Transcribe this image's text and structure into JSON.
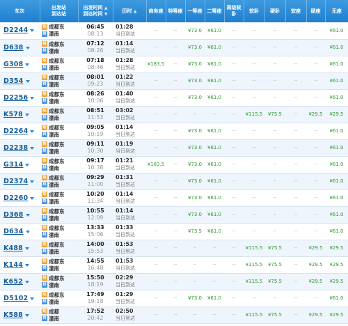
{
  "headers": {
    "train": "车次",
    "station_from": "出发站",
    "station_to": "到达站",
    "time_dep": "出发时间",
    "time_arr": "到达时间",
    "duration": "历时",
    "seats": [
      "商务座",
      "特等座",
      "一等座",
      "二等座",
      "高级软卧",
      "软卧",
      "硬卧",
      "软座",
      "硬座",
      "无座"
    ]
  },
  "colors": {
    "header_bg": "#1f7fcf",
    "train_link": "#135d9b",
    "available": "#2f9a2f",
    "row_alt": "#eef5fc"
  },
  "icons": {
    "start_station": "始",
    "end_station": "终"
  },
  "rows": [
    {
      "train": "D2244",
      "from": "成都东",
      "to": "潼南",
      "dep": "06:45",
      "arr": "08:13",
      "dur": "01:28",
      "day": "当日到达",
      "seats": [
        "--",
        "--",
        "¥73.0",
        "¥61.0",
        "--",
        "--",
        "--",
        "--",
        "--",
        "¥61.0"
      ]
    },
    {
      "train": "D638",
      "from": "成都东",
      "to": "潼南",
      "dep": "07:12",
      "arr": "08:26",
      "dur": "01:14",
      "day": "当日到达",
      "seats": [
        "--",
        "--",
        "¥73.0",
        "¥61.0",
        "--",
        "--",
        "--",
        "--",
        "--",
        "¥61.0"
      ]
    },
    {
      "train": "G308",
      "from": "成都东",
      "to": "潼南",
      "dep": "07:18",
      "arr": "08:46",
      "dur": "01:28",
      "day": "当日到达",
      "seats": [
        "¥183.5",
        "--",
        "¥73.0",
        "¥61.0",
        "--",
        "--",
        "--",
        "--",
        "--",
        "¥61.0"
      ]
    },
    {
      "train": "D354",
      "from": "成都东",
      "to": "潼南",
      "dep": "08:01",
      "arr": "09:23",
      "dur": "01:22",
      "day": "当日到达",
      "seats": [
        "--",
        "--",
        "¥73.0",
        "¥61.0",
        "--",
        "--",
        "--",
        "--",
        "--",
        "¥61.0"
      ]
    },
    {
      "train": "D2256",
      "from": "成都东",
      "to": "潼南",
      "dep": "08:26",
      "arr": "10:06",
      "dur": "01:40",
      "day": "当日到达",
      "seats": [
        "--",
        "--",
        "¥73.0",
        "¥61.0",
        "--",
        "--",
        "--",
        "--",
        "--",
        "¥61.0"
      ]
    },
    {
      "train": "K578",
      "from": "成都东",
      "to": "潼南",
      "dep": "08:51",
      "arr": "11:53",
      "dur": "03:02",
      "day": "当日到达",
      "seats": [
        "--",
        "--",
        "--",
        "--",
        "--",
        "¥115.5",
        "¥75.5",
        "--",
        "¥29.5",
        "¥29.5"
      ]
    },
    {
      "train": "D2264",
      "from": "成都东",
      "to": "潼南",
      "dep": "09:05",
      "arr": "10:19",
      "dur": "01:14",
      "day": "当日到达",
      "seats": [
        "--",
        "--",
        "¥73.0",
        "¥61.0",
        "--",
        "--",
        "--",
        "--",
        "--",
        "¥61.0"
      ]
    },
    {
      "train": "D2238",
      "from": "成都东",
      "to": "潼南",
      "dep": "09:11",
      "arr": "10:30",
      "dur": "01:19",
      "day": "当日到达",
      "seats": [
        "--",
        "--",
        "¥73.0",
        "¥61.0",
        "--",
        "--",
        "--",
        "--",
        "--",
        "¥61.0"
      ]
    },
    {
      "train": "G314",
      "from": "成都东",
      "to": "潼南",
      "dep": "09:17",
      "arr": "10:38",
      "dur": "01:21",
      "day": "当日到达",
      "seats": [
        "¥183.5",
        "--",
        "¥73.0",
        "¥61.0",
        "--",
        "--",
        "--",
        "--",
        "--",
        "¥61.0"
      ]
    },
    {
      "train": "D2374",
      "from": "成都东",
      "to": "潼南",
      "dep": "09:29",
      "arr": "11:00",
      "dur": "01:31",
      "day": "当日到达",
      "seats": [
        "--",
        "--",
        "¥73.0",
        "¥61.0",
        "--",
        "--",
        "--",
        "--",
        "--",
        "¥61.0"
      ]
    },
    {
      "train": "D2260",
      "from": "成都东",
      "to": "潼南",
      "dep": "10:20",
      "arr": "11:34",
      "dur": "01:14",
      "day": "当日到达",
      "seats": [
        "--",
        "--",
        "¥73.0",
        "¥61.0",
        "--",
        "--",
        "--",
        "--",
        "--",
        "¥61.0"
      ]
    },
    {
      "train": "D368",
      "from": "成都东",
      "to": "潼南",
      "dep": "10:55",
      "arr": "12:09",
      "dur": "01:14",
      "day": "当日到达",
      "seats": [
        "--",
        "--",
        "¥73.0",
        "¥61.0",
        "--",
        "--",
        "--",
        "--",
        "--",
        "¥61.0"
      ]
    },
    {
      "train": "D634",
      "from": "成都东",
      "to": "潼南",
      "dep": "13:33",
      "arr": "15:06",
      "dur": "01:33",
      "day": "当日到达",
      "seats": [
        "--",
        "--",
        "¥73.5",
        "¥61.0",
        "--",
        "--",
        "--",
        "--",
        "--",
        "¥61.0"
      ]
    },
    {
      "train": "K488",
      "from": "成都东",
      "to": "潼南",
      "dep": "14:00",
      "arr": "15:53",
      "dur": "01:53",
      "day": "当日到达",
      "seats": [
        "--",
        "--",
        "--",
        "--",
        "--",
        "¥115.5",
        "¥75.5",
        "--",
        "¥29.5",
        "¥29.5"
      ]
    },
    {
      "train": "K144",
      "from": "成都东",
      "to": "潼南",
      "dep": "14:55",
      "arr": "16:48",
      "dur": "01:53",
      "day": "当日到达",
      "seats": [
        "--",
        "--",
        "--",
        "--",
        "--",
        "¥115.5",
        "¥75.5",
        "--",
        "¥29.5",
        "¥29.5"
      ]
    },
    {
      "train": "K652",
      "from": "成都东",
      "to": "潼南",
      "dep": "15:50",
      "arr": "18:19",
      "dur": "02:29",
      "day": "当日到达",
      "seats": [
        "--",
        "--",
        "--",
        "--",
        "--",
        "¥115.5",
        "¥75.5",
        "--",
        "¥29.5",
        "¥29.5"
      ]
    },
    {
      "train": "D5102",
      "from": "成都东",
      "to": "潼南",
      "dep": "17:49",
      "arr": "19:18",
      "dur": "01:29",
      "day": "当日到达",
      "seats": [
        "--",
        "--",
        "¥73.0",
        "¥61.0",
        "--",
        "--",
        "--",
        "--",
        "--",
        "¥61.0"
      ]
    },
    {
      "train": "K588",
      "from": "成都",
      "to": "潼南",
      "dep": "17:52",
      "arr": "20:42",
      "dur": "02:50",
      "day": "当日到达",
      "seats": [
        "--",
        "--",
        "--",
        "--",
        "--",
        "¥115.5",
        "¥75.5",
        "--",
        "¥29.5",
        "¥29.5"
      ]
    }
  ]
}
